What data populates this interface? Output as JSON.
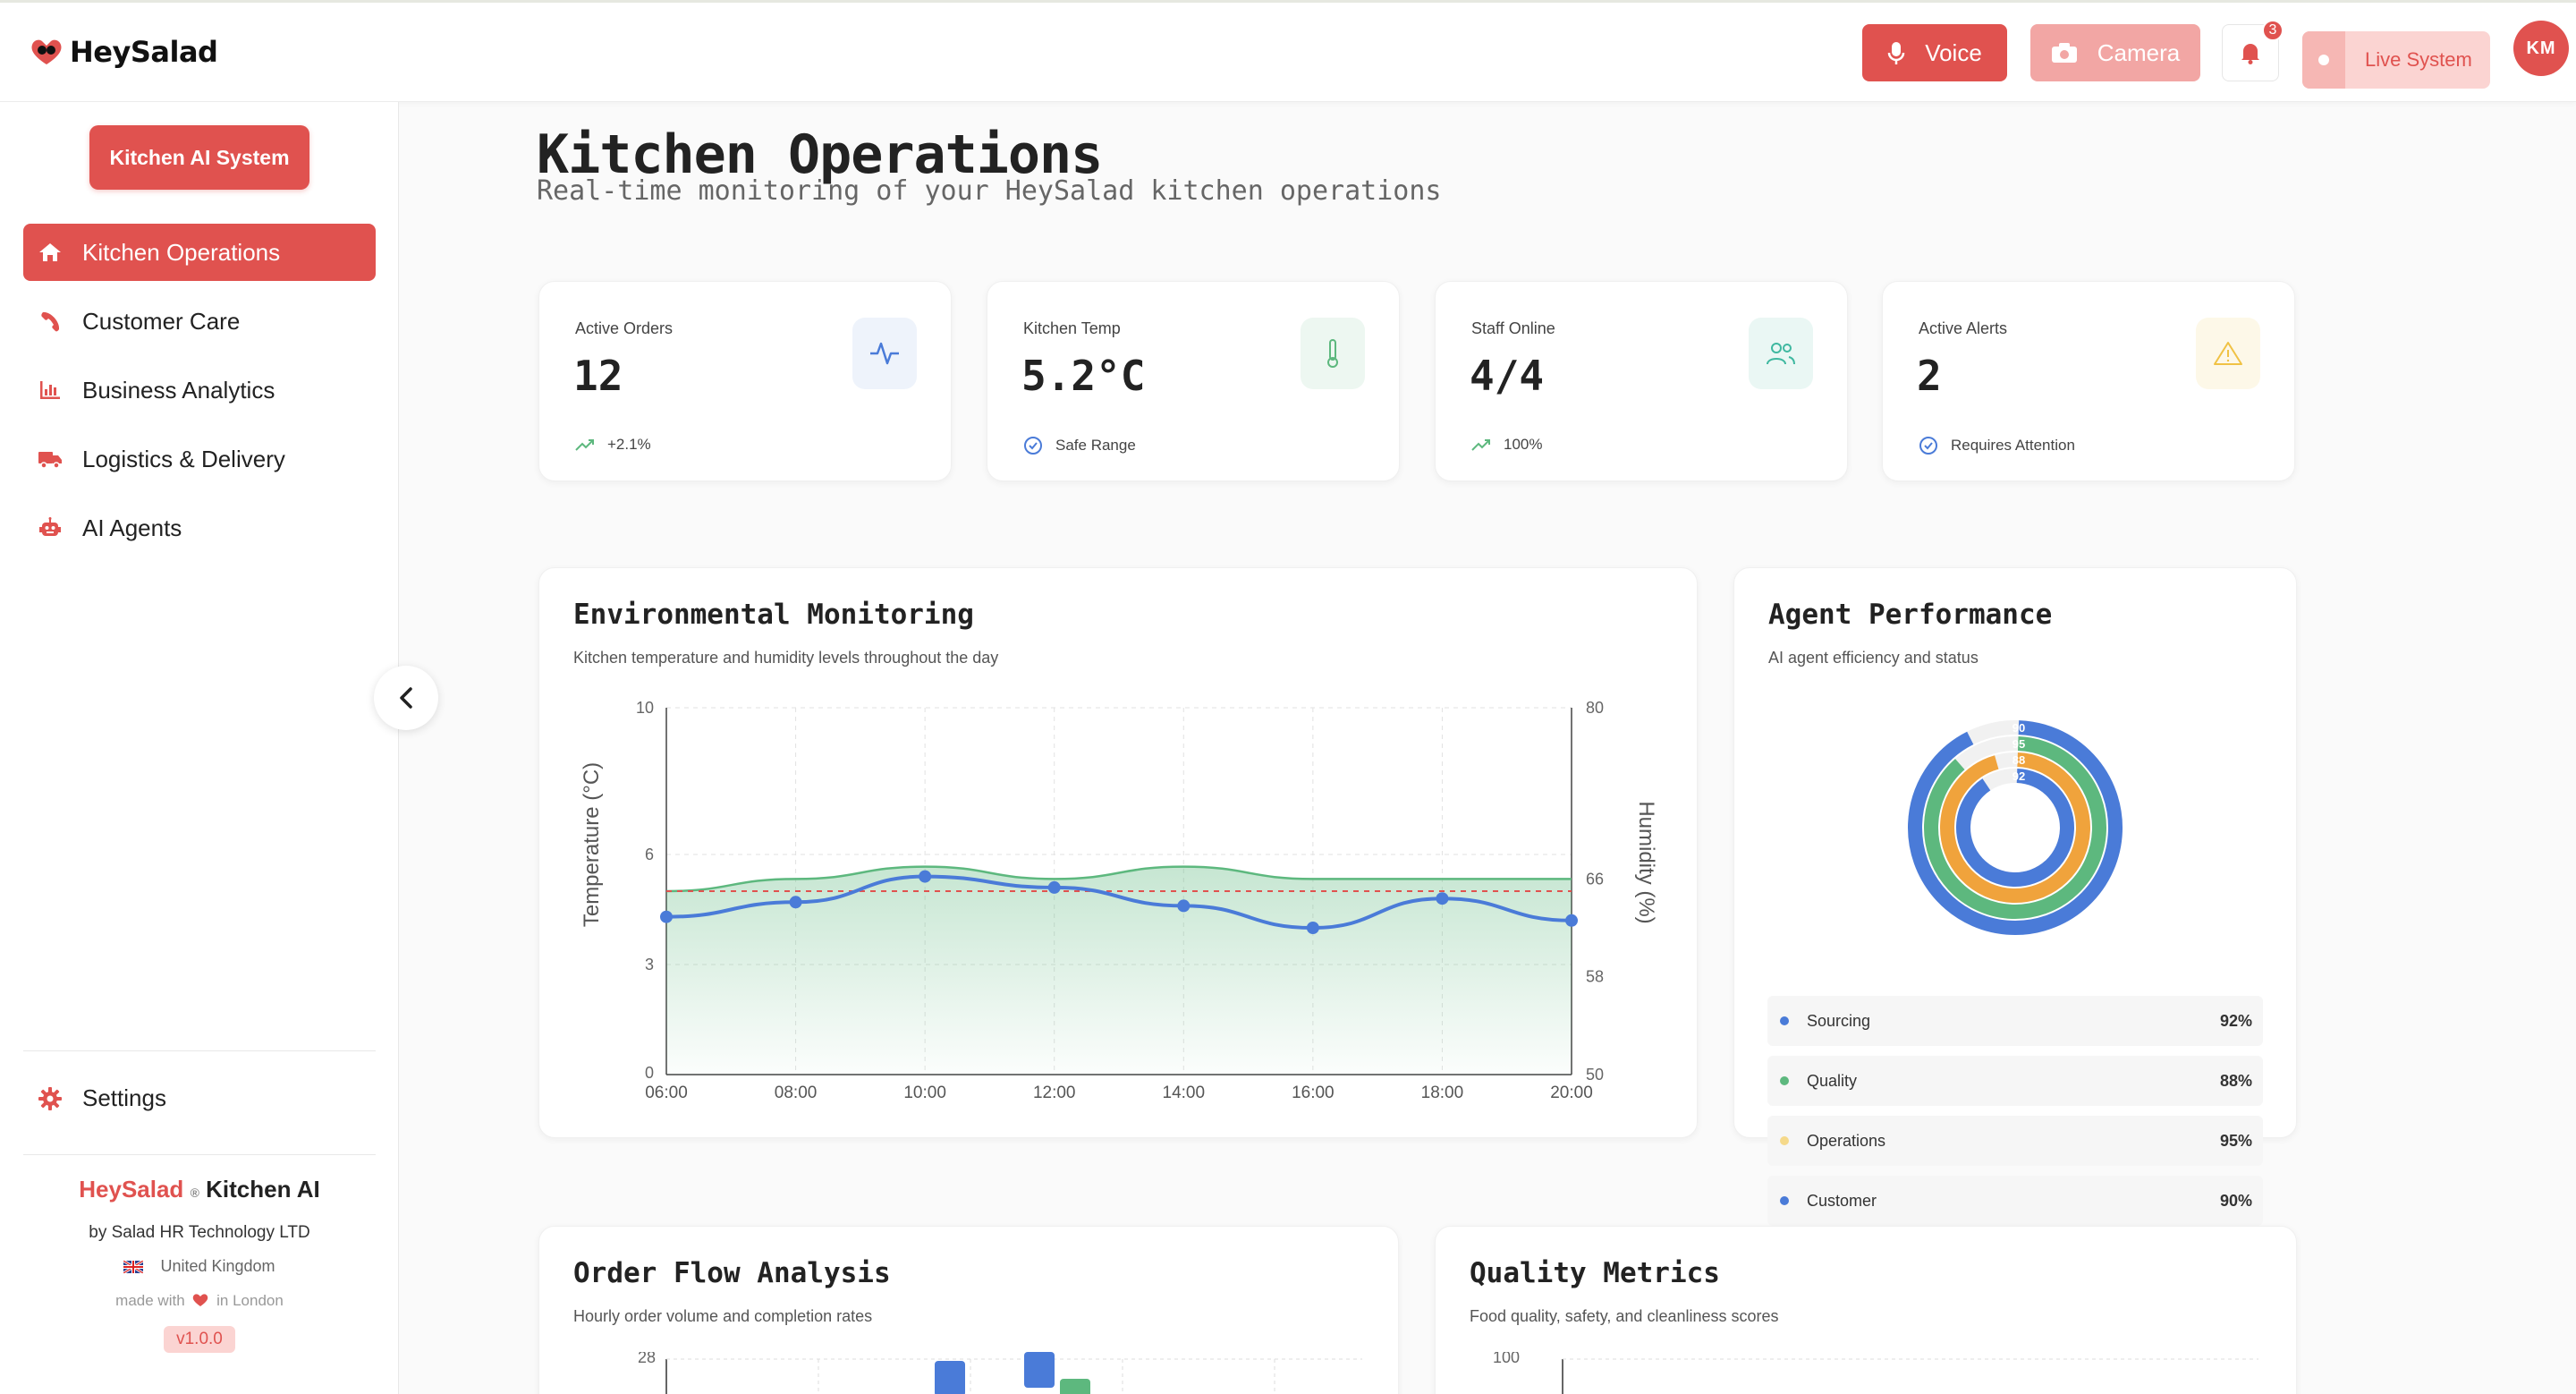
{
  "topbar": {
    "logo_text": "HeySalad",
    "voice_label": "Voice",
    "camera_label": "Camera",
    "notification_count": "3",
    "live_label": "Live System",
    "avatar_initials": "KM"
  },
  "sidebar": {
    "header_button": "Kitchen AI System",
    "items": [
      {
        "label": "Kitchen Operations",
        "icon": "home-icon",
        "active": true
      },
      {
        "label": "Customer Care",
        "icon": "phone-icon",
        "active": false
      },
      {
        "label": "Business Analytics",
        "icon": "bar-chart-icon",
        "active": false
      },
      {
        "label": "Logistics & Delivery",
        "icon": "truck-icon",
        "active": false
      },
      {
        "label": "AI Agents",
        "icon": "robot-icon",
        "active": false
      }
    ],
    "settings_label": "Settings",
    "footer": {
      "brand_red": "HeySalad",
      "brand_reg": "®",
      "brand_rest": "Kitchen AI",
      "by": "by Salad HR Technology LTD",
      "country": "United Kingdom",
      "made_prefix": "made with",
      "made_suffix": "in London",
      "version": "v1.0.0"
    }
  },
  "page": {
    "title": "Kitchen Operations",
    "subtitle": "Real-time monitoring of your HeySalad kitchen operations"
  },
  "stats": [
    {
      "label": "Active Orders",
      "value": "12",
      "foot": "+2.1%",
      "icon": "activity-icon",
      "foot_icon": "trending-up-icon"
    },
    {
      "label": "Kitchen Temp",
      "value": "5.2°C",
      "foot": "Safe Range",
      "icon": "thermometer-icon",
      "foot_icon": "check-circle-icon"
    },
    {
      "label": "Staff Online",
      "value": "4/4",
      "foot": "100%",
      "icon": "users-icon",
      "foot_icon": "trending-up-icon"
    },
    {
      "label": "Active Alerts",
      "value": "2",
      "foot": "Requires Attention",
      "icon": "warning-icon",
      "foot_icon": "check-circle-icon"
    }
  ],
  "env_panel": {
    "title": "Environmental Monitoring",
    "subtitle": "Kitchen temperature and humidity levels throughout the day"
  },
  "agent_panel": {
    "title": "Agent Performance",
    "subtitle": "AI agent efficiency and status",
    "rows": [
      {
        "name": "Sourcing",
        "value": "92%",
        "color": "#4a7bd8"
      },
      {
        "name": "Quality",
        "value": "88%",
        "color": "#5db87e"
      },
      {
        "name": "Operations",
        "value": "95%",
        "color": "#f5d98a"
      },
      {
        "name": "Customer",
        "value": "90%",
        "color": "#4a7bd8"
      }
    ],
    "ring_labels": [
      "90",
      "95",
      "88",
      "92"
    ]
  },
  "order_panel": {
    "title": "Order Flow Analysis",
    "subtitle": "Hourly order volume and completion rates",
    "y_top_label": "28"
  },
  "quality_panel": {
    "title": "Quality Metrics",
    "subtitle": "Food quality, safety, and cleanliness scores",
    "y_top_label": "100"
  },
  "chart_data": [
    {
      "type": "line",
      "x": [
        "06:00",
        "08:00",
        "10:00",
        "12:00",
        "14:00",
        "16:00",
        "18:00",
        "20:00"
      ],
      "series": [
        {
          "name": "Temperature (°C)",
          "axis": "left",
          "values": [
            4.3,
            4.7,
            5.4,
            5.1,
            4.6,
            4.0,
            4.8,
            4.2
          ],
          "color": "#4a7bd8"
        },
        {
          "name": "Humidity (%)",
          "axis": "right",
          "values": [
            65,
            66,
            67,
            66,
            67,
            66,
            66,
            66
          ],
          "color": "#5db87e"
        }
      ],
      "reference_line": {
        "axis": "left",
        "value": 5.0,
        "color": "#e0524f"
      },
      "ylabel": "Temperature (°C)",
      "y2label": "Humidity (%)",
      "ylim": [
        0,
        10
      ],
      "y2lim": [
        50,
        80
      ],
      "yticks": [
        "0",
        "3",
        "6",
        "10"
      ],
      "y2ticks": [
        "50",
        "58",
        "66",
        "80"
      ],
      "grid": true
    },
    {
      "type": "radial-bar",
      "categories": [
        "Sourcing",
        "Quality",
        "Operations",
        "Customer"
      ],
      "values": [
        92,
        88,
        95,
        90
      ],
      "colors": [
        "#4a7bd8",
        "#5db87e",
        "#f0a33c",
        "#4a7bd8"
      ]
    }
  ]
}
